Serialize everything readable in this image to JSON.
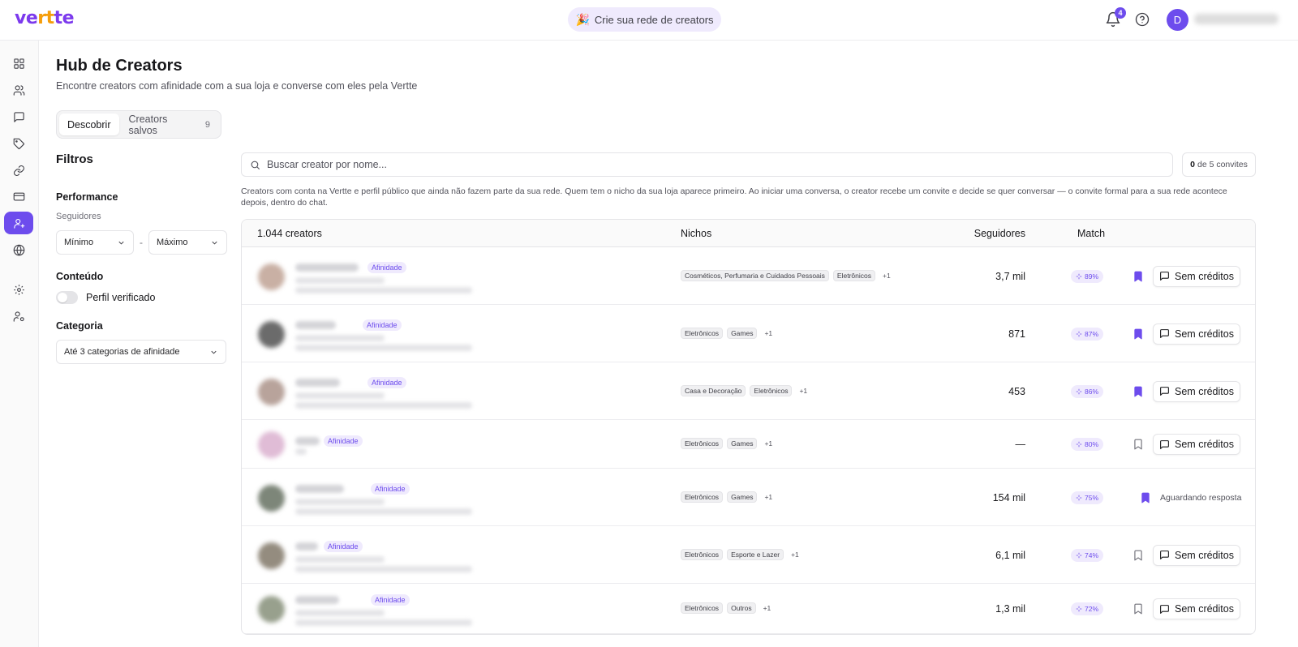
{
  "brand": {
    "logo_v": "ve",
    "logo_o": "rt",
    "logo_rest": "te"
  },
  "header": {
    "promo": "Crie sua rede de creators",
    "notifications_count": "4",
    "avatar_initial": "D"
  },
  "page": {
    "title": "Hub de Creators",
    "subtitle": "Encontre creators com afinidade com a sua loja e converse com eles pela Vertte",
    "tabs": [
      {
        "label": "Descobrir"
      },
      {
        "label": "Creators salvos",
        "count": "9"
      }
    ]
  },
  "filters": {
    "title": "Filtros",
    "performance": "Performance",
    "followers_label": "Seguidores",
    "min_placeholder": "Mínimo",
    "range_sep": "-",
    "max_placeholder": "Máximo",
    "content": "Conteúdo",
    "verified": "Perfil verificado",
    "verified_on": false,
    "category": "Categoria",
    "category_placeholder": "Até 3 categorias de afinidade"
  },
  "search": {
    "placeholder": "Buscar creator por nome..."
  },
  "invites": {
    "used": "0",
    "rest": "de 5 convites"
  },
  "description": "Creators com conta na Vertte e perfil público que ainda não fazem parte da sua rede. Quem tem o nicho da sua loja aparece primeiro. Ao iniciar uma conversa, o creator recebe um convite e decide se quer conversar — o convite formal para a sua rede acontece depois, dentro do chat.",
  "table": {
    "count_label": "1.044 creators",
    "col_niches": "Nichos",
    "col_followers": "Seguidores",
    "col_match": "Match",
    "affinity_label": "Afinidade",
    "button_label": "Sem créditos",
    "pending_label": "Aguardando resposta",
    "rows": [
      {
        "niches": [
          "Cosméticos, Perfumaria e Cuidados Pessoais",
          "Eletrônicos"
        ],
        "more": "+1",
        "followers": "3,7 mil",
        "match": "89%",
        "saved": true,
        "status": "button"
      },
      {
        "niches": [
          "Eletrônicos",
          "Games"
        ],
        "more": "+1",
        "followers": "871",
        "match": "87%",
        "saved": true,
        "status": "button"
      },
      {
        "niches": [
          "Casa e Decoração",
          "Eletrônicos"
        ],
        "more": "+1",
        "followers": "453",
        "match": "86%",
        "saved": true,
        "status": "button"
      },
      {
        "niches": [
          "Eletrônicos",
          "Games"
        ],
        "more": "+1",
        "followers": "—",
        "match": "80%",
        "saved": false,
        "status": "button"
      },
      {
        "niches": [
          "Eletrônicos",
          "Games"
        ],
        "more": "+1",
        "followers": "154 mil",
        "match": "75%",
        "saved": true,
        "status": "pending"
      },
      {
        "niches": [
          "Eletrônicos",
          "Esporte e Lazer"
        ],
        "more": "+1",
        "followers": "6,1 mil",
        "match": "74%",
        "saved": false,
        "status": "button"
      },
      {
        "niches": [
          "Eletrônicos",
          "Outros"
        ],
        "more": "+1",
        "followers": "1,3 mil",
        "match": "72%",
        "saved": false,
        "status": "button"
      }
    ]
  },
  "colors": {
    "accent": "#6d4ced",
    "accent_soft": "#efeafd",
    "logo_orange": "#f59e0b"
  },
  "icons": [
    "dashboard-icon",
    "users-icon",
    "chat-icon",
    "tag-icon",
    "link-icon",
    "card-icon",
    "creators-icon",
    "globe-icon",
    "settings-icon",
    "user-cog-icon",
    "bell-icon",
    "help-icon",
    "search-icon",
    "chevron-down-icon",
    "bookmark-icon",
    "sparkle-icon",
    "party-icon"
  ]
}
